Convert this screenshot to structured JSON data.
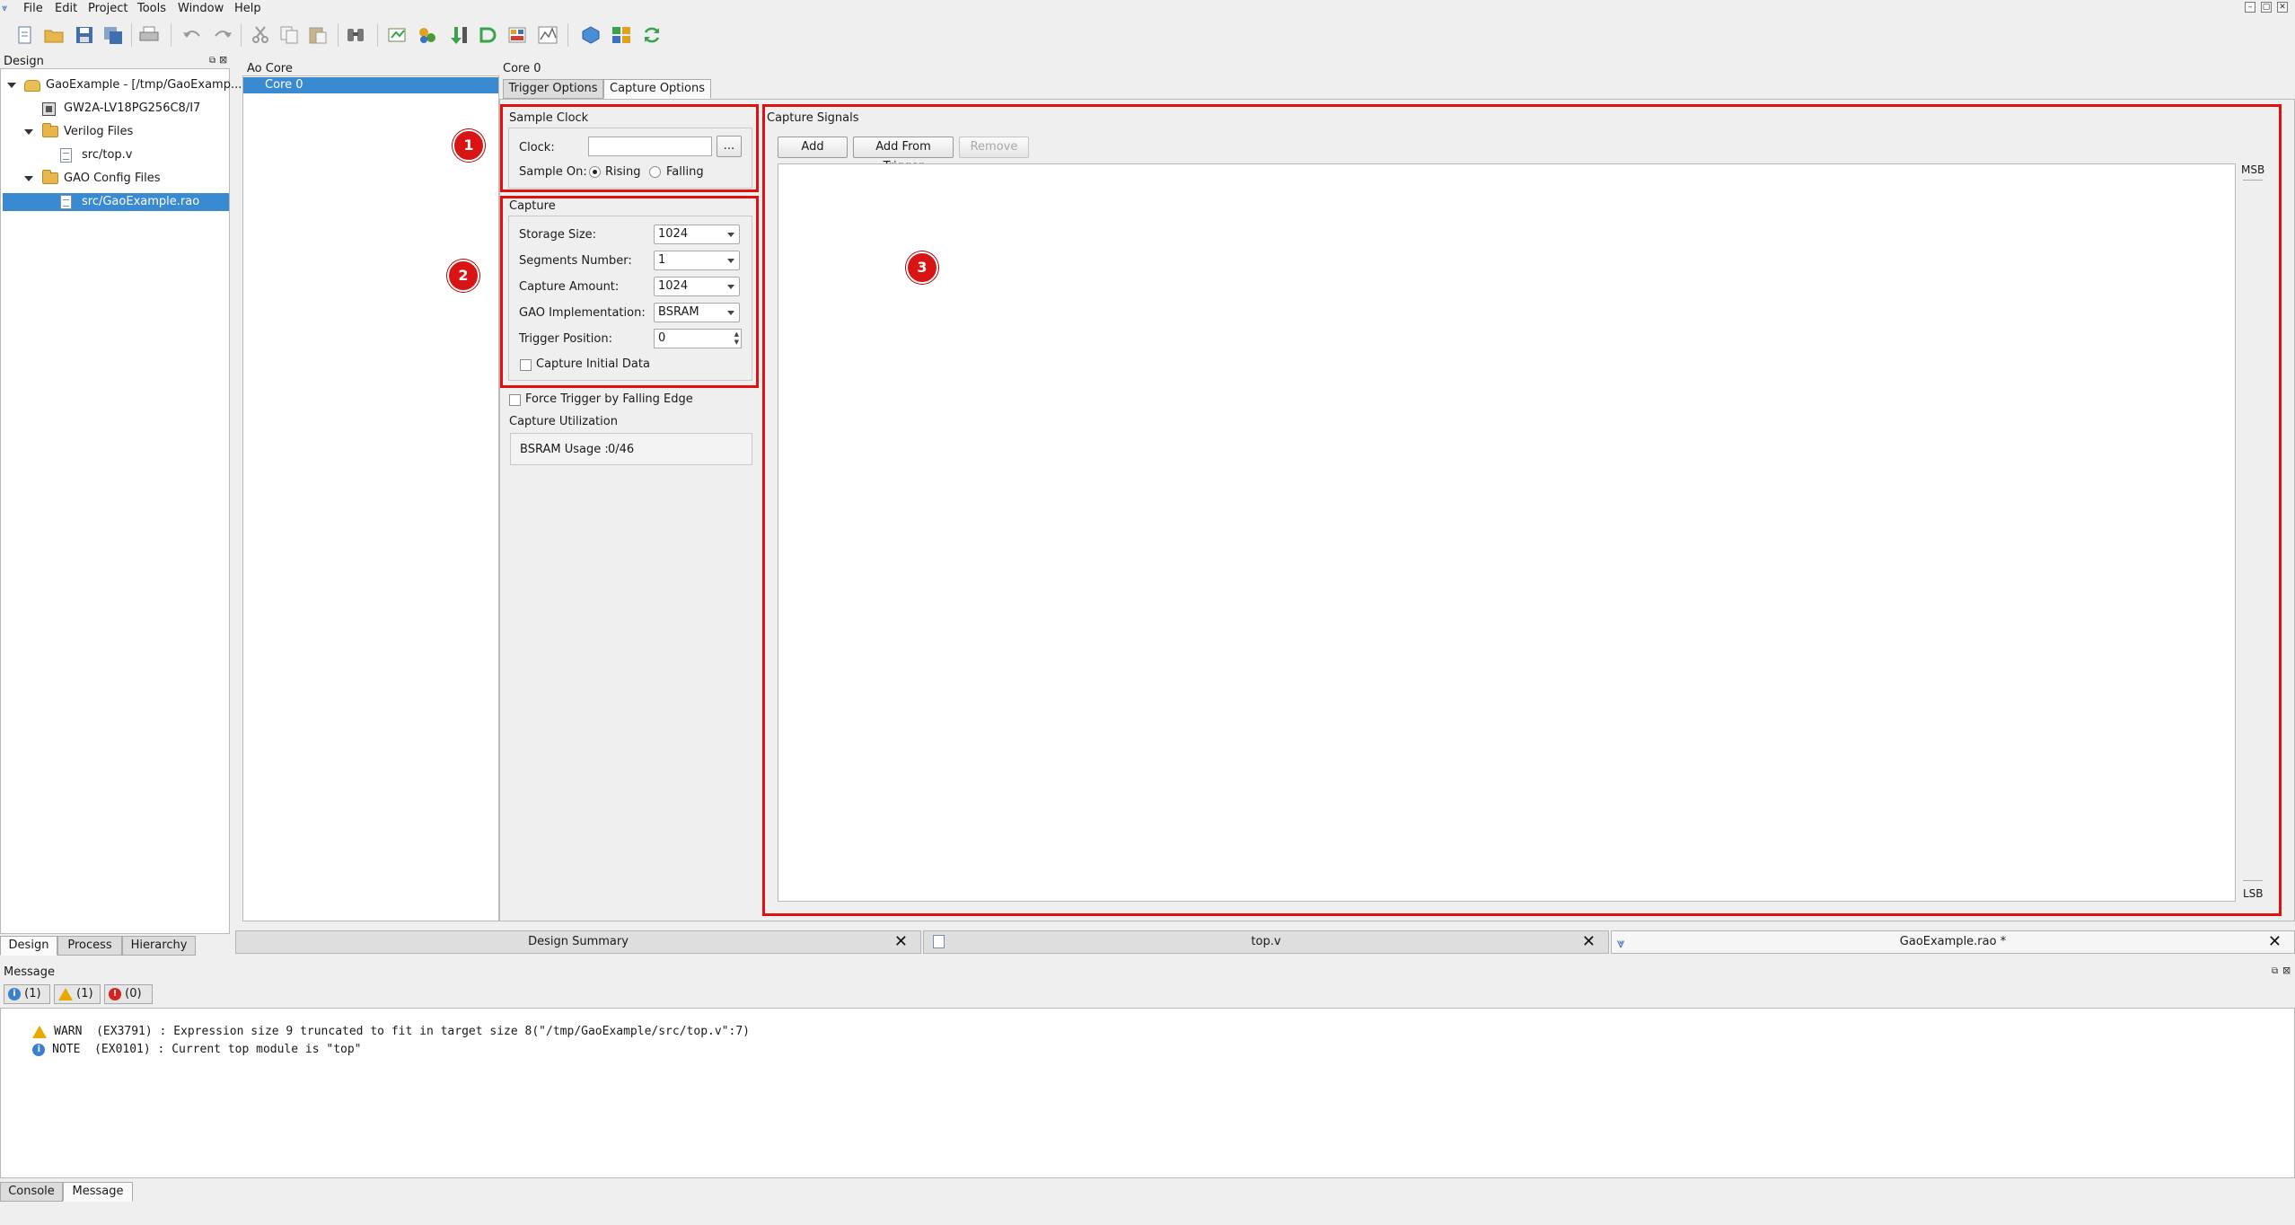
{
  "menu": [
    "File",
    "Edit",
    "Project",
    "Tools",
    "Window",
    "Help"
  ],
  "toolbar_icons": [
    "new-file-icon",
    "open-folder-icon",
    "save-icon",
    "save-all-icon",
    "print-icon",
    "undo-icon",
    "redo-icon",
    "cut-icon",
    "copy-icon",
    "paste-icon",
    "find-icon",
    "synthesize-icon",
    "place-route-icon",
    "program-device-icon",
    "gao-icon",
    "floorplanner-icon",
    "timing-icon",
    "power-icon",
    "ip-core-icon",
    "refresh-icon"
  ],
  "design_panel": {
    "title": "Design",
    "tree": [
      {
        "label": "GaoExample - [/tmp/GaoExamp...",
        "type": "project"
      },
      {
        "label": "GW2A-LV18PG256C8/I7",
        "type": "chip"
      },
      {
        "label": "Verilog Files",
        "type": "folder"
      },
      {
        "label": "src/top.v",
        "type": "file"
      },
      {
        "label": "GAO Config Files",
        "type": "folder"
      },
      {
        "label": "src/GaoExample.rao",
        "type": "file",
        "selected": true
      }
    ],
    "tabs": [
      "Design",
      "Process",
      "Hierarchy"
    ]
  },
  "ao_core": {
    "title": "Ao Core",
    "items": [
      "Core 0"
    ]
  },
  "core_panel": {
    "title": "Core 0",
    "tabs": [
      "Trigger Options",
      "Capture Options"
    ],
    "active_tab": "Capture Options",
    "sample_clock": {
      "title": "Sample Clock",
      "clock_label": "Clock:",
      "clock_value": "",
      "browse_label": "...",
      "sample_on_label": "Sample On:",
      "rising_label": "Rising",
      "falling_label": "Falling",
      "selected": "Rising"
    },
    "capture": {
      "title": "Capture",
      "storage_size_label": "Storage Size:",
      "storage_size_value": "1024",
      "segments_label": "Segments Number:",
      "segments_value": "1",
      "capture_amount_label": "Capture Amount:",
      "capture_amount_value": "1024",
      "gao_impl_label": "GAO Implementation:",
      "gao_impl_value": "BSRAM",
      "trigger_pos_label": "Trigger Position:",
      "trigger_pos_value": "0",
      "capture_initial_label": "Capture Initial Data",
      "capture_initial_checked": false
    },
    "force_trigger_label": "Force Trigger by Falling Edge",
    "force_trigger_checked": false,
    "utilization": {
      "title": "Capture Utilization",
      "bsram_label": "BSRAM Usage :",
      "bsram_value": "0/46"
    },
    "capture_signals": {
      "title": "Capture Signals",
      "add_label": "Add",
      "add_from_trigger_label": "Add From Trigger",
      "remove_label": "Remove",
      "msb_label": "MSB",
      "lsb_label": "LSB"
    }
  },
  "annotations": [
    "1",
    "2",
    "3"
  ],
  "annotation_color": "#e01010",
  "doc_tabs": [
    {
      "label": "Design Summary"
    },
    {
      "label": "top.v"
    },
    {
      "label": "GaoExample.rao *"
    }
  ],
  "message_panel": {
    "title": "Message",
    "filters": [
      {
        "icon": "info-icon",
        "count": "(1)"
      },
      {
        "icon": "warning-icon",
        "count": "(1)"
      },
      {
        "icon": "error-icon",
        "count": "(0)"
      }
    ],
    "messages": [
      {
        "level": "warning",
        "text": "WARN  (EX3791) : Expression size 9 truncated to fit in target size 8(\"/tmp/GaoExample/src/top.v\":7)"
      },
      {
        "level": "info",
        "text": "NOTE  (EX0101) : Current top module is \"top\""
      }
    ],
    "bottom_tabs": [
      "Console",
      "Message"
    ]
  },
  "selection_color": "#3a8ad2"
}
